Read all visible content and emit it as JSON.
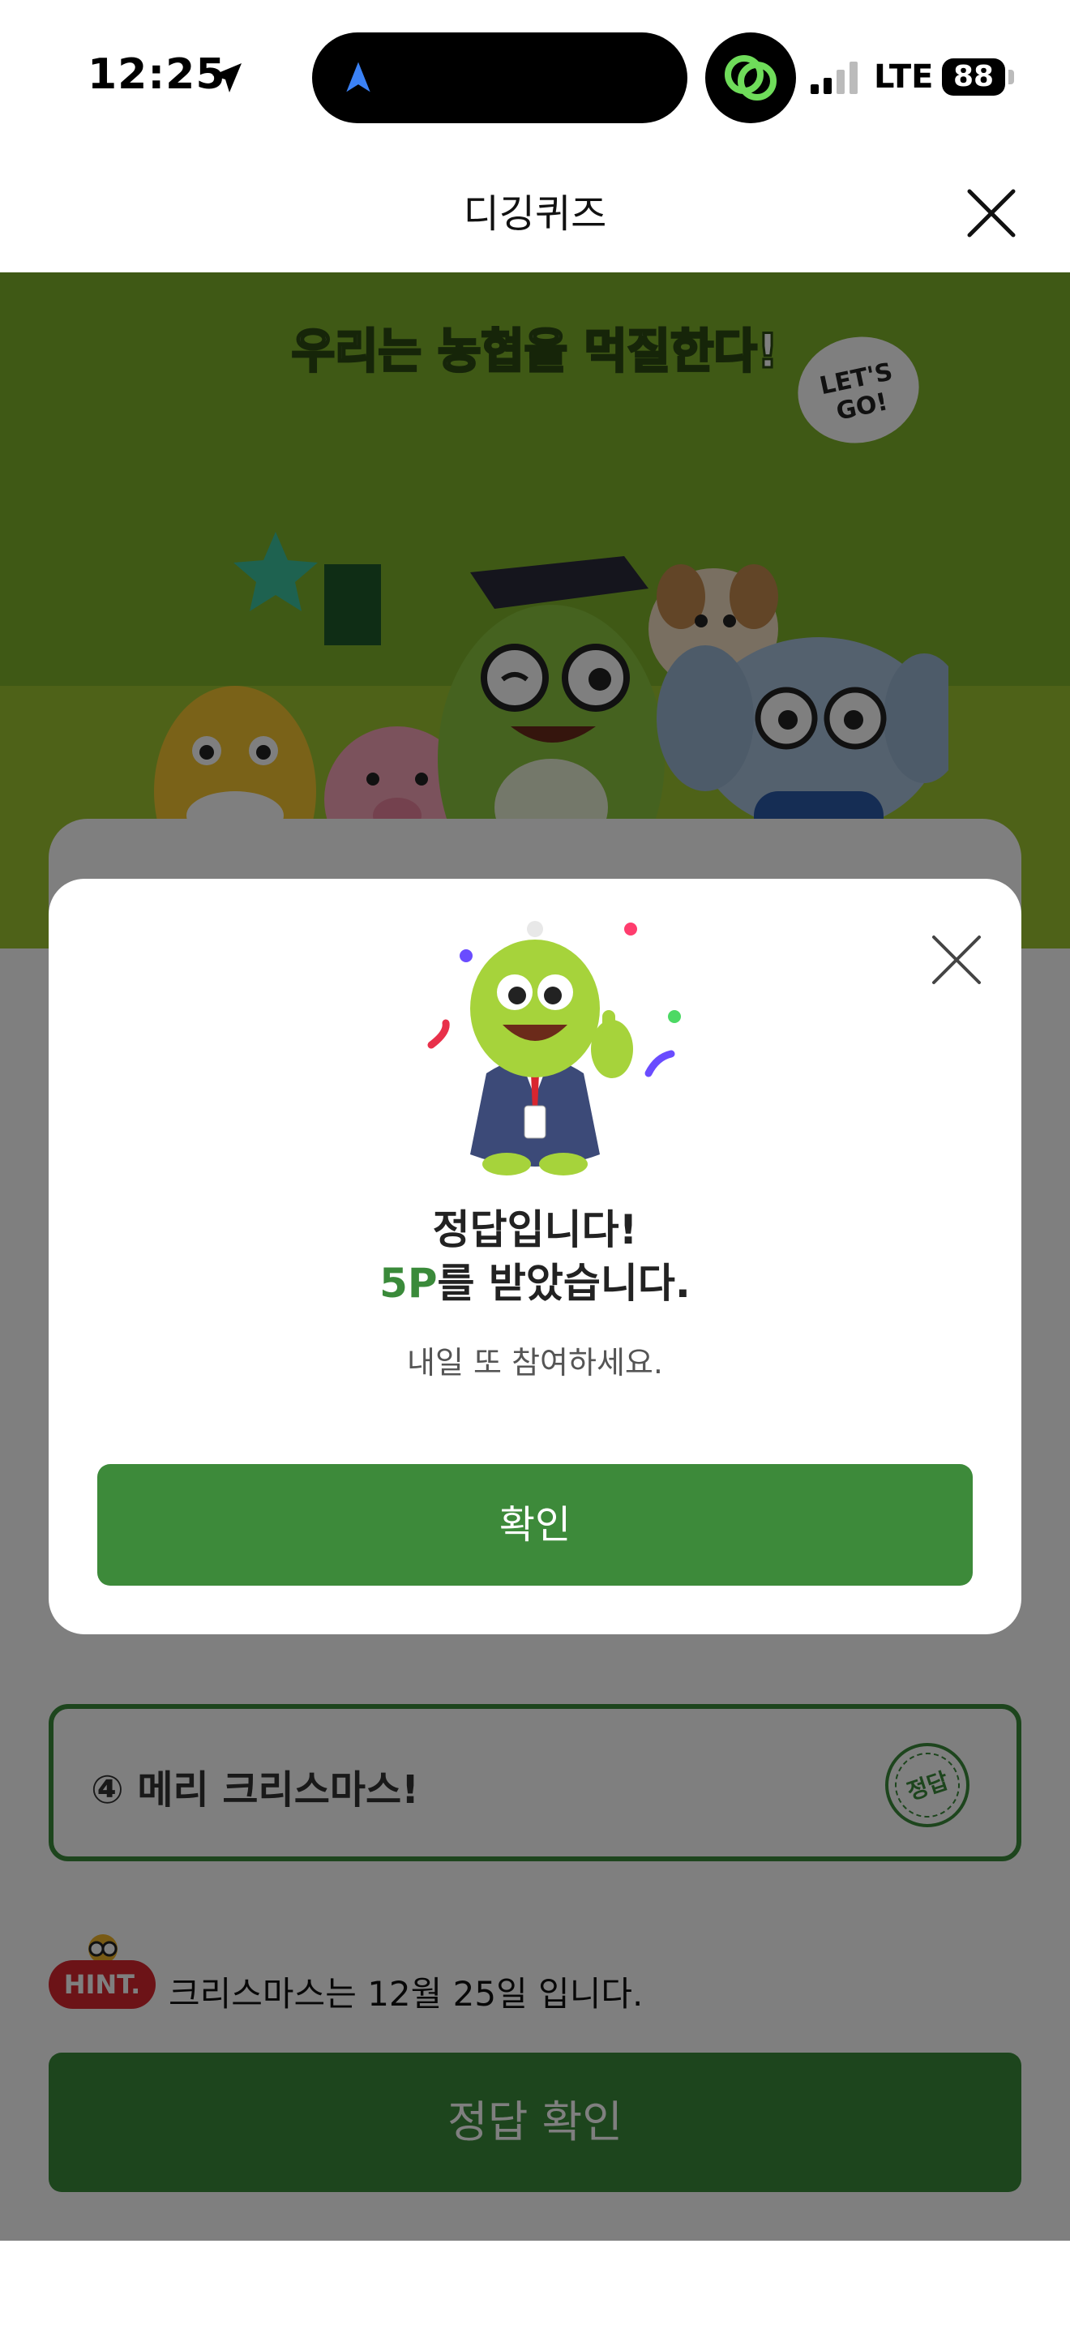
{
  "status_bar": {
    "time": "12:25",
    "network": "LTE",
    "battery": "88"
  },
  "nav": {
    "title": "디깅퀴즈"
  },
  "hero": {
    "slogan": "우리는 농협을 먹질한다!",
    "bubble": "LET'S GO!"
  },
  "quiz": {
    "option": "④ 메리 크리스마스!",
    "stamp": "정답",
    "hint_badge": "HINT.",
    "hint_text": "크리스마스는 12월 25일 입니다.",
    "submit_label": "정답 확인"
  },
  "modal": {
    "title_line1": "정답입니다!",
    "points": "5P",
    "title_line2_rest": "를 받았습니다.",
    "subtitle": "내일 또 참여하세요.",
    "confirm_label": "확인"
  },
  "colors": {
    "brand_green": "#3a8a3a",
    "hint_red": "#d8262f",
    "hero_green": "#7eb22b"
  }
}
